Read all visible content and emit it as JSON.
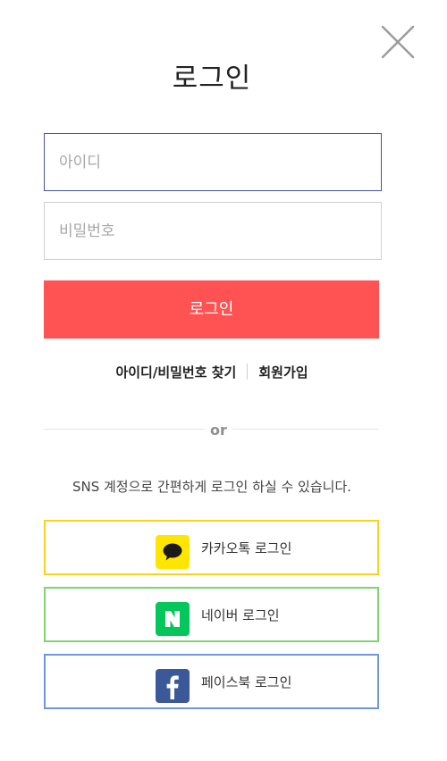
{
  "header": {
    "title": "로그인",
    "close_icon": "close-icon"
  },
  "form": {
    "id_placeholder": "아이디",
    "password_placeholder": "비밀번호",
    "login_label": "로그인",
    "login_color": "#ff5253",
    "focused_border_color": "#45529b"
  },
  "links": {
    "find_account": "아이디/비밀번호 찾기",
    "signup": "회원가입"
  },
  "divider": {
    "text": "or"
  },
  "sns": {
    "info": "SNS 계정으로 간편하게 로그인 하실 수 있습니다.",
    "buttons": [
      {
        "label": "카카오톡 로그인",
        "icon": "kakao-icon",
        "border_color": "#f7d31c",
        "icon_color": "#ffe600"
      },
      {
        "label": "네이버 로그인",
        "icon": "naver-icon",
        "border_color": "#7fd56b",
        "icon_color": "#03c75a"
      },
      {
        "label": "페이스북 로그인",
        "icon": "facebook-icon",
        "border_color": "#6c97e0",
        "icon_color": "#3b5998"
      }
    ]
  }
}
